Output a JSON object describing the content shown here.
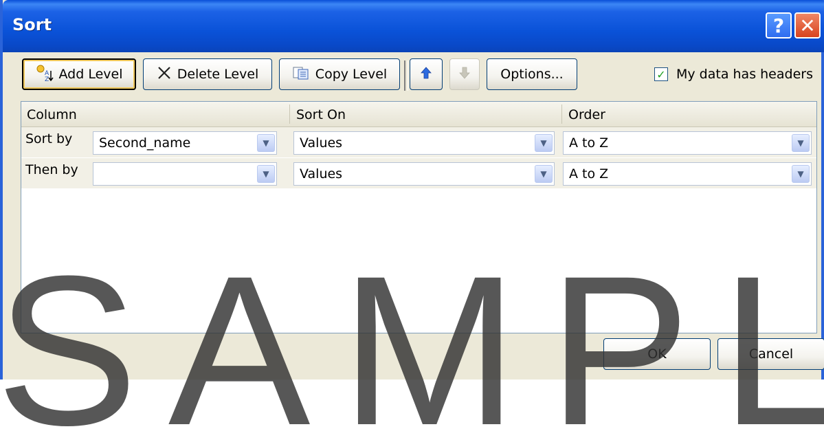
{
  "window": {
    "title": "Sort",
    "help_glyph": "?",
    "close_glyph": "✕"
  },
  "toolbar": {
    "add_level": "Add Level",
    "delete_level": "Delete Level",
    "copy_level": "Copy Level",
    "options": "Options...",
    "my_data_has_headers": "My data has headers",
    "headers_checked": true
  },
  "grid": {
    "columns": [
      "Column",
      "Sort On",
      "Order"
    ],
    "rows": [
      {
        "label": "Sort by",
        "column": "Second_name",
        "sort_on": "Values",
        "order": "A to Z"
      },
      {
        "label": "Then by",
        "column": "",
        "sort_on": "Values",
        "order": "A to Z"
      }
    ]
  },
  "buttons": {
    "ok": "OK",
    "cancel": "Cancel"
  },
  "watermark": "SAMPLE",
  "colors": {
    "title_bar": "#0a52d8",
    "dialog_bg": "#ece9d8",
    "close_red": "#d8431e"
  }
}
